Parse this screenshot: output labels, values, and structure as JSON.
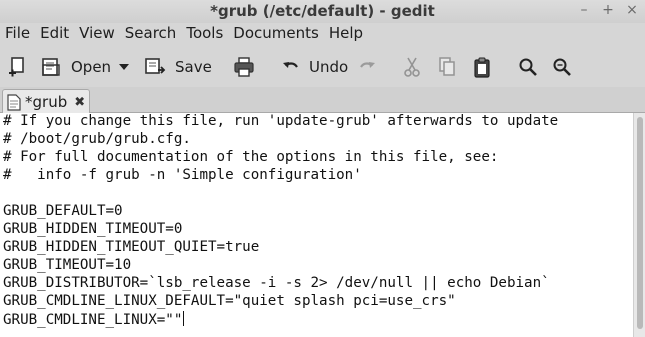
{
  "window": {
    "title": "*grub (/etc/default) - gedit",
    "minimize": "–",
    "maximize": "+",
    "close": "×"
  },
  "menu": [
    "File",
    "Edit",
    "View",
    "Search",
    "Tools",
    "Documents",
    "Help"
  ],
  "toolbar": {
    "open_label": "Open",
    "save_label": "Save",
    "undo_label": "Undo"
  },
  "tab": {
    "name": "*grub",
    "close": "✖"
  },
  "editor": {
    "lines": [
      "# If you change this file, run 'update-grub' afterwards to update",
      "# /boot/grub/grub.cfg.",
      "# For full documentation of the options in this file, see:",
      "#   info -f grub -n 'Simple configuration'",
      "",
      "GRUB_DEFAULT=0",
      "GRUB_HIDDEN_TIMEOUT=0",
      "GRUB_HIDDEN_TIMEOUT_QUIET=true",
      "GRUB_TIMEOUT=10",
      "GRUB_DISTRIBUTOR=`lsb_release -i -s 2> /dev/null || echo Debian`",
      "GRUB_CMDLINE_LINUX_DEFAULT=\"quiet splash pci=use_crs\"",
      "GRUB_CMDLINE_LINUX=\"\""
    ]
  },
  "colors": {
    "chrome": "#d6d6d6",
    "editor_bg": "#ffffff",
    "text": "#111111"
  }
}
